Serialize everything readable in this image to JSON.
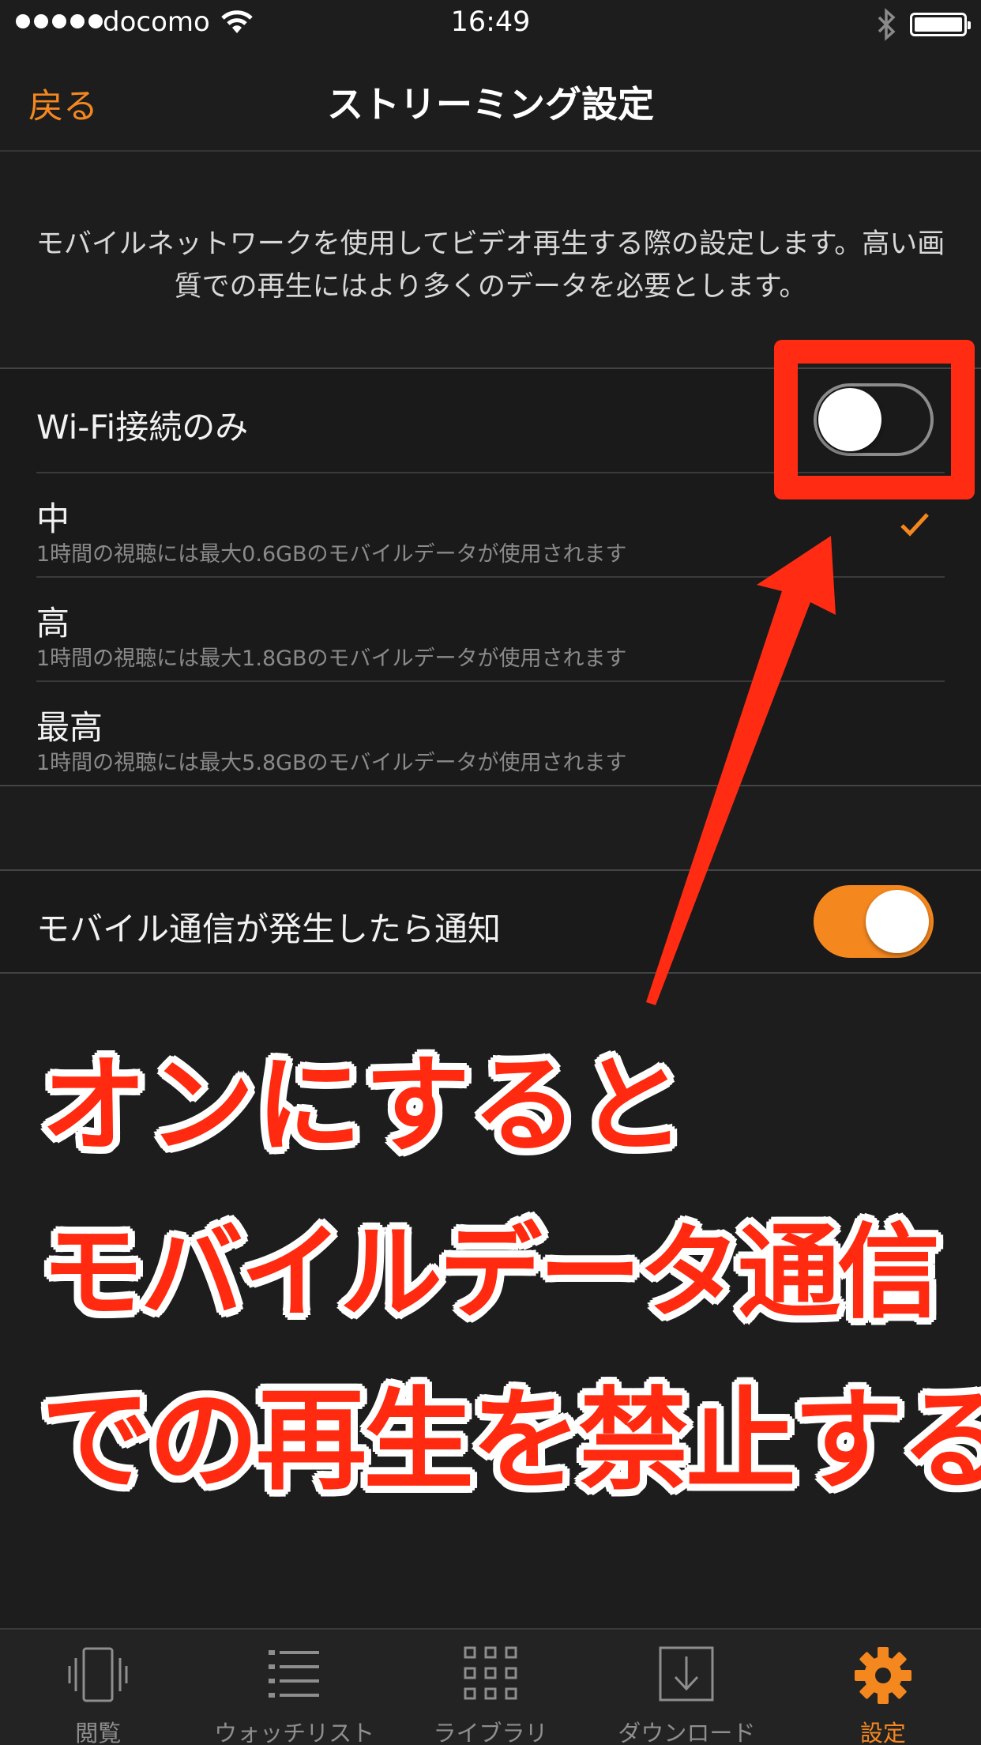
{
  "status_bar": {
    "carrier": "docomo",
    "time": "16:49"
  },
  "nav": {
    "back_label": "戻る",
    "title": "ストリーミング設定"
  },
  "description": "モバイルネットワークを使用してビデオ再生する際の設定します。高い画質での再生にはより多くのデータを必要とします。",
  "quality_group": {
    "wifi_only": {
      "label": "Wi-Fi接続のみ",
      "enabled": false
    },
    "options": [
      {
        "label": "中",
        "sub": "1時間の視聴には最大0.6GBのモバイルデータが使用されます",
        "selected": true
      },
      {
        "label": "高",
        "sub": "1時間の視聴には最大1.8GBのモバイルデータが使用されます",
        "selected": false
      },
      {
        "label": "最高",
        "sub": "1時間の視聴には最大5.8GBのモバイルデータが使用されます",
        "selected": false
      }
    ]
  },
  "notify_group": {
    "label": "モバイル通信が発生したら通知",
    "enabled": true
  },
  "annotation": {
    "line1": "オンにすると",
    "line2": "モバイルデータ通信",
    "line3": "での再生を禁止する",
    "color": "#ff2b13"
  },
  "tab_bar": {
    "tabs": [
      {
        "label": "閲覧",
        "icon": "browse-icon",
        "active": false
      },
      {
        "label": "ウォッチリスト",
        "icon": "list-icon",
        "active": false
      },
      {
        "label": "ライブラリ",
        "icon": "grid-icon",
        "active": false
      },
      {
        "label": "ダウンロード",
        "icon": "download-icon",
        "active": false
      },
      {
        "label": "設定",
        "icon": "gear-icon",
        "active": true
      }
    ]
  },
  "colors": {
    "accent": "#f5871f",
    "background": "#1d1d1d"
  }
}
